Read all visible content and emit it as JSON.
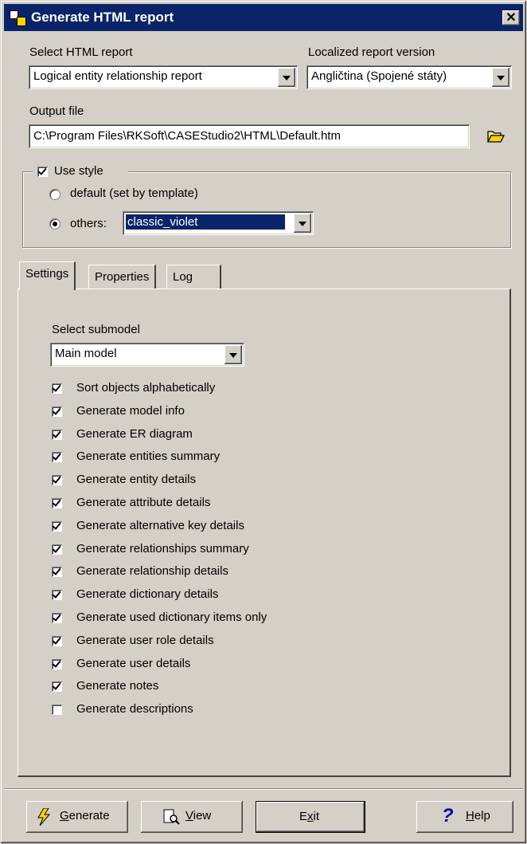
{
  "window": {
    "title": "Generate HTML report"
  },
  "report": {
    "label": "Select HTML report",
    "value": "Logical entity relationship report"
  },
  "localized": {
    "label": "Localized report version",
    "value": "Angličtina (Spojené státy)"
  },
  "output": {
    "label": "Output file",
    "value": "C:\\Program Files\\RKSoft\\CASEStudio2\\HTML\\Default.htm",
    "browse_icon": "folder-open-icon"
  },
  "style": {
    "use_style_label": "Use style",
    "use_style_checked": true,
    "default_label": "default (set by template)",
    "others_label": "others:",
    "selected": "others",
    "others_value": "classic_violet"
  },
  "tabs": [
    {
      "label": "Settings",
      "active": true
    },
    {
      "label": "Properties",
      "active": false
    },
    {
      "label": "Log",
      "active": false
    }
  ],
  "settings": {
    "submodel_label": "Select submodel",
    "submodel_value": "Main model",
    "options": [
      {
        "label": "Sort objects alphabetically",
        "checked": true
      },
      {
        "label": "Generate model info",
        "checked": true
      },
      {
        "label": "Generate ER diagram",
        "checked": true
      },
      {
        "label": "Generate entities summary",
        "checked": true
      },
      {
        "label": "Generate entity details",
        "checked": true
      },
      {
        "label": "Generate attribute details",
        "checked": true
      },
      {
        "label": "Generate alternative key details",
        "checked": true
      },
      {
        "label": "Generate relationships summary",
        "checked": true
      },
      {
        "label": "Generate relationship details",
        "checked": true
      },
      {
        "label": "Generate dictionary details",
        "checked": true
      },
      {
        "label": "Generate used dictionary items only",
        "checked": true
      },
      {
        "label": "Generate user role details",
        "checked": true
      },
      {
        "label": "Generate user details",
        "checked": true
      },
      {
        "label": "Generate notes",
        "checked": true
      },
      {
        "label": "Generate descriptions",
        "checked": false
      }
    ]
  },
  "buttons": {
    "generate": {
      "label": "Generate",
      "mnemonic": "G",
      "rest": "enerate",
      "icon": "lightning-icon"
    },
    "view": {
      "label": "View",
      "mnemonic": "V",
      "rest": "iew",
      "icon": "document-magnifier-icon"
    },
    "exit": {
      "label": "Exit",
      "pre": "E",
      "mnemonic": "x",
      "rest": "it"
    },
    "help": {
      "label": "Help",
      "mnemonic": "H",
      "rest": "elp",
      "icon": "question-mark-icon"
    }
  },
  "colors": {
    "titlebar": "#0a246a",
    "selection": "#0a246a",
    "face": "#d4d0c8"
  }
}
